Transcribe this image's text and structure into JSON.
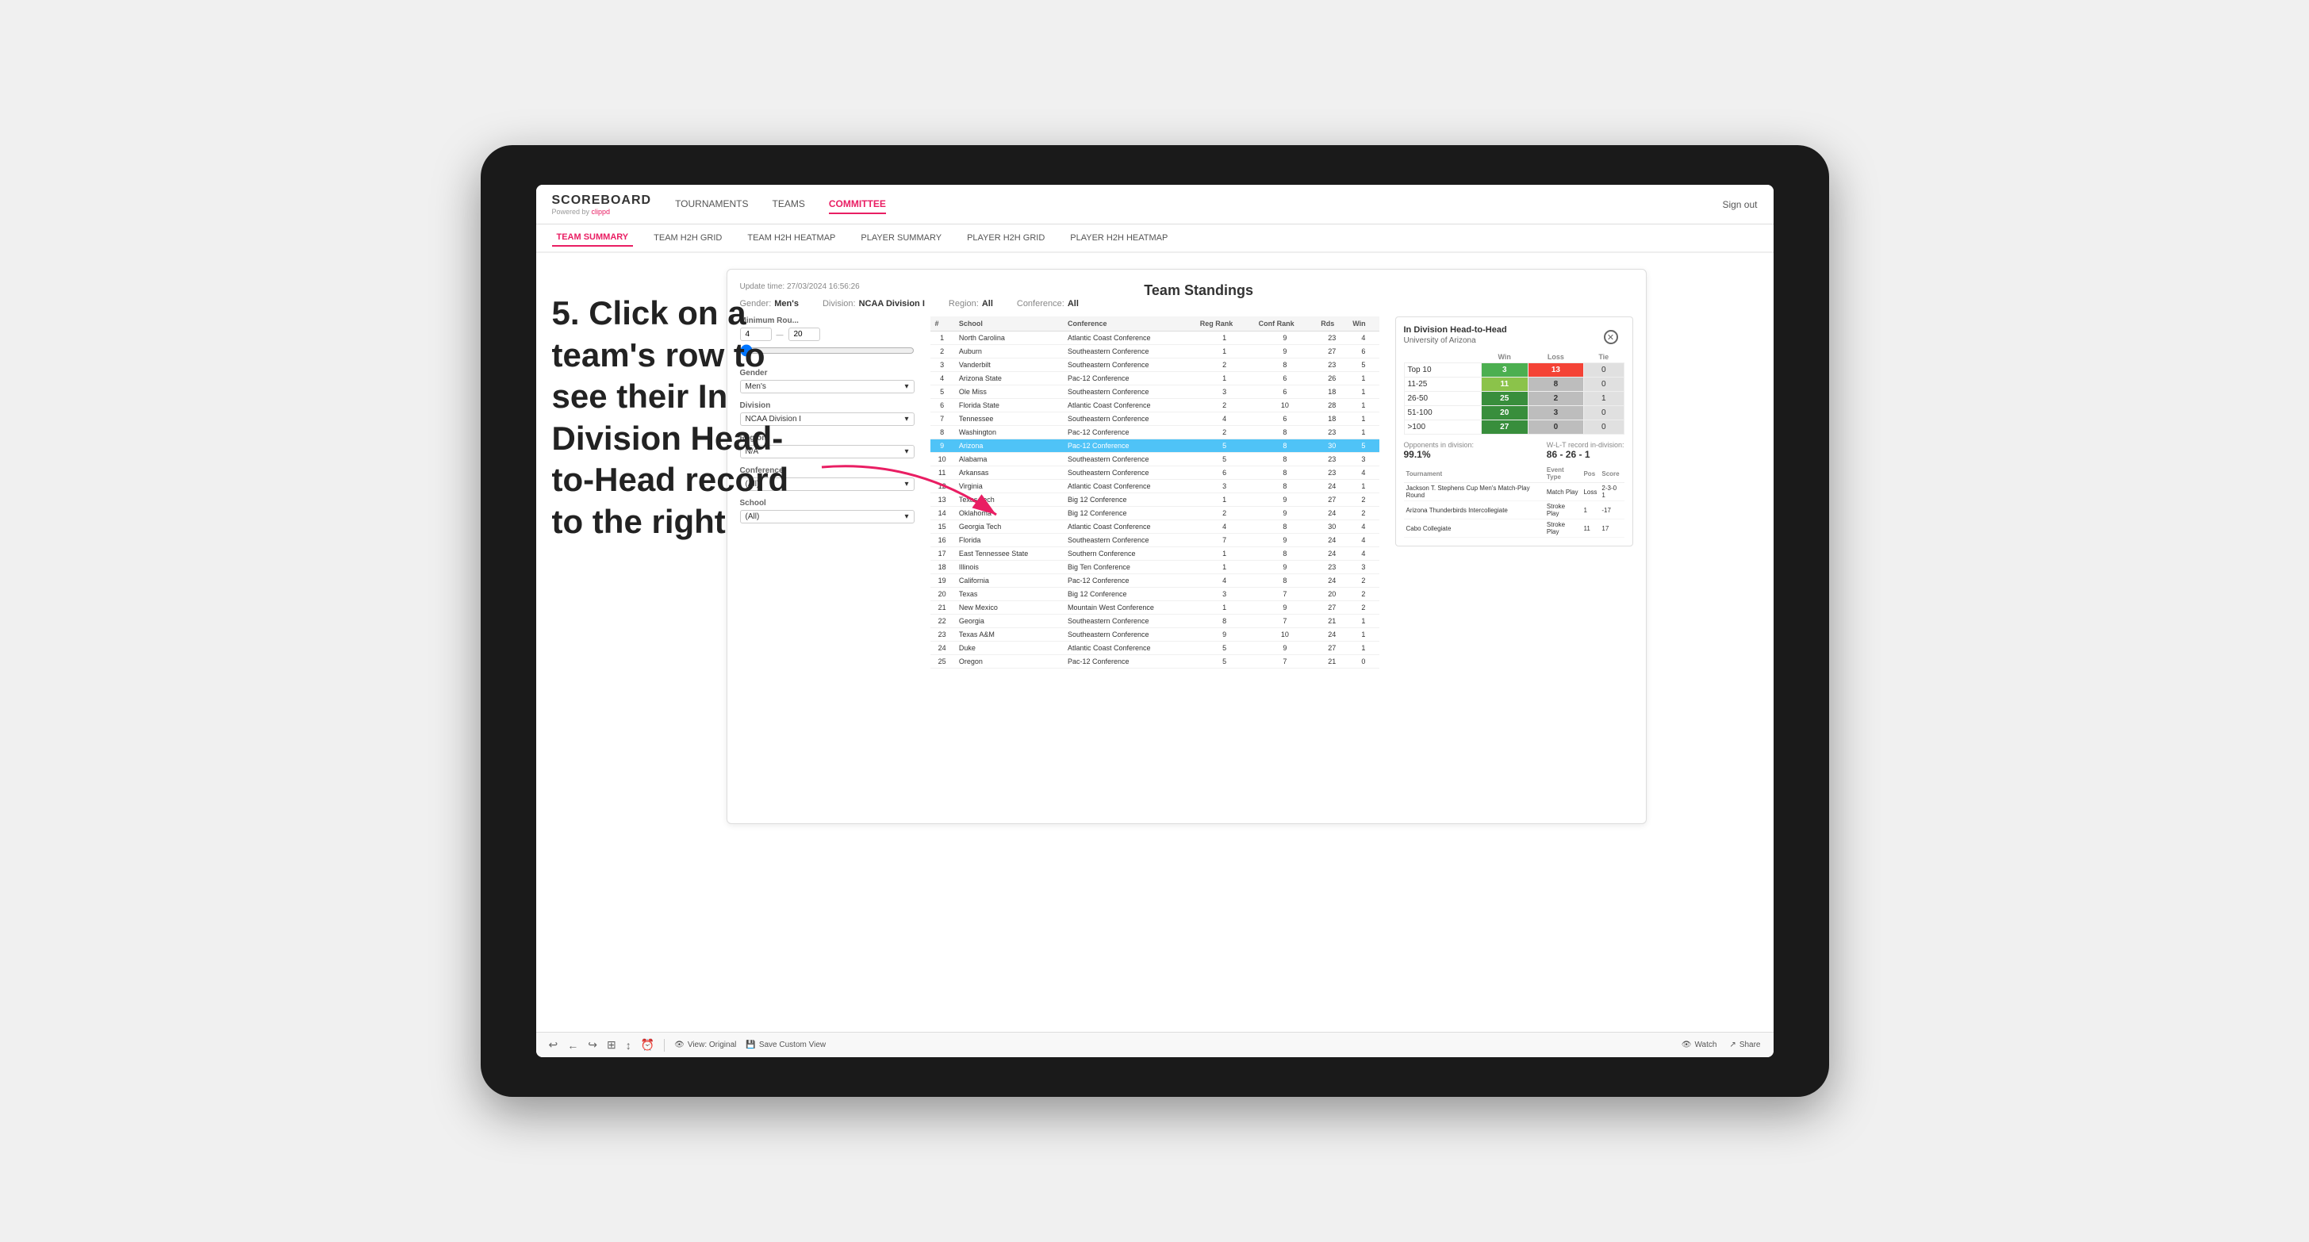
{
  "page": {
    "background": "#e8e8e8"
  },
  "annotation": {
    "text": "5. Click on a team's row to see their In Division Head-to-Head record to the right"
  },
  "logo": {
    "title": "SCOREBOARD",
    "subtitle": "Powered by",
    "brand": "clippd"
  },
  "nav": {
    "items": [
      {
        "label": "TOURNAMENTS",
        "active": false
      },
      {
        "label": "TEAMS",
        "active": false
      },
      {
        "label": "COMMITTEE",
        "active": true
      }
    ],
    "sign_out": "Sign out"
  },
  "sub_nav": {
    "items": [
      {
        "label": "TEAM SUMMARY",
        "active": true
      },
      {
        "label": "TEAM H2H GRID",
        "active": false
      },
      {
        "label": "TEAM H2H HEATMAP",
        "active": false
      },
      {
        "label": "PLAYER SUMMARY",
        "active": false
      },
      {
        "label": "PLAYER H2H GRID",
        "active": false
      },
      {
        "label": "PLAYER H2H HEATMAP",
        "active": false
      }
    ]
  },
  "panel": {
    "title": "Team Standings",
    "update_time": "Update time:",
    "update_date": "27/03/2024 16:56:26",
    "filters": {
      "gender": {
        "label": "Gender:",
        "value": "Men's"
      },
      "division": {
        "label": "Division:",
        "value": "NCAA Division I"
      },
      "region": {
        "label": "Region:",
        "value": "All"
      },
      "conference": {
        "label": "Conference:",
        "value": "All"
      }
    }
  },
  "left_filters": {
    "minimum_rounds": {
      "label": "Minimum Rou...",
      "value": "4",
      "max": "20"
    },
    "gender": {
      "label": "Gender",
      "value": "Men's"
    },
    "division": {
      "label": "Division",
      "value": "NCAA Division I"
    },
    "region": {
      "label": "Region",
      "value": "N/A"
    },
    "conference": {
      "label": "Conference",
      "value": "(All)"
    },
    "school": {
      "label": "School",
      "value": "(All)"
    }
  },
  "table": {
    "headers": [
      "#",
      "School",
      "Conference",
      "Reg Rank",
      "Conf Rank",
      "Rds",
      "Win"
    ],
    "rows": [
      {
        "num": 1,
        "school": "North Carolina",
        "conference": "Atlantic Coast Conference",
        "reg_rank": 1,
        "conf_rank": 9,
        "rds": 23,
        "win": 4
      },
      {
        "num": 2,
        "school": "Auburn",
        "conference": "Southeastern Conference",
        "reg_rank": 1,
        "conf_rank": 9,
        "rds": 27,
        "win": 6
      },
      {
        "num": 3,
        "school": "Vanderbilt",
        "conference": "Southeastern Conference",
        "reg_rank": 2,
        "conf_rank": 8,
        "rds": 23,
        "win": 5
      },
      {
        "num": 4,
        "school": "Arizona State",
        "conference": "Pac-12 Conference",
        "reg_rank": 1,
        "conf_rank": 6,
        "rds": 26,
        "win": 1
      },
      {
        "num": 5,
        "school": "Ole Miss",
        "conference": "Southeastern Conference",
        "reg_rank": 3,
        "conf_rank": 6,
        "rds": 18,
        "win": 1
      },
      {
        "num": 6,
        "school": "Florida State",
        "conference": "Atlantic Coast Conference",
        "reg_rank": 2,
        "conf_rank": 10,
        "rds": 28,
        "win": 1
      },
      {
        "num": 7,
        "school": "Tennessee",
        "conference": "Southeastern Conference",
        "reg_rank": 4,
        "conf_rank": 6,
        "rds": 18,
        "win": 1
      },
      {
        "num": 8,
        "school": "Washington",
        "conference": "Pac-12 Conference",
        "reg_rank": 2,
        "conf_rank": 8,
        "rds": 23,
        "win": 1
      },
      {
        "num": 9,
        "school": "Arizona",
        "conference": "Pac-12 Conference",
        "reg_rank": 5,
        "conf_rank": 8,
        "rds": 30,
        "win": 5,
        "highlighted": true
      },
      {
        "num": 10,
        "school": "Alabama",
        "conference": "Southeastern Conference",
        "reg_rank": 5,
        "conf_rank": 8,
        "rds": 23,
        "win": 3
      },
      {
        "num": 11,
        "school": "Arkansas",
        "conference": "Southeastern Conference",
        "reg_rank": 6,
        "conf_rank": 8,
        "rds": 23,
        "win": 4
      },
      {
        "num": 12,
        "school": "Virginia",
        "conference": "Atlantic Coast Conference",
        "reg_rank": 3,
        "conf_rank": 8,
        "rds": 24,
        "win": 1
      },
      {
        "num": 13,
        "school": "Texas Tech",
        "conference": "Big 12 Conference",
        "reg_rank": 1,
        "conf_rank": 9,
        "rds": 27,
        "win": 2
      },
      {
        "num": 14,
        "school": "Oklahoma",
        "conference": "Big 12 Conference",
        "reg_rank": 2,
        "conf_rank": 9,
        "rds": 24,
        "win": 2
      },
      {
        "num": 15,
        "school": "Georgia Tech",
        "conference": "Atlantic Coast Conference",
        "reg_rank": 4,
        "conf_rank": 8,
        "rds": 30,
        "win": 4
      },
      {
        "num": 16,
        "school": "Florida",
        "conference": "Southeastern Conference",
        "reg_rank": 7,
        "conf_rank": 9,
        "rds": 24,
        "win": 4
      },
      {
        "num": 17,
        "school": "East Tennessee State",
        "conference": "Southern Conference",
        "reg_rank": 1,
        "conf_rank": 8,
        "rds": 24,
        "win": 4
      },
      {
        "num": 18,
        "school": "Illinois",
        "conference": "Big Ten Conference",
        "reg_rank": 1,
        "conf_rank": 9,
        "rds": 23,
        "win": 3
      },
      {
        "num": 19,
        "school": "California",
        "conference": "Pac-12 Conference",
        "reg_rank": 4,
        "conf_rank": 8,
        "rds": 24,
        "win": 2
      },
      {
        "num": 20,
        "school": "Texas",
        "conference": "Big 12 Conference",
        "reg_rank": 3,
        "conf_rank": 7,
        "rds": 20,
        "win": 2
      },
      {
        "num": 21,
        "school": "New Mexico",
        "conference": "Mountain West Conference",
        "reg_rank": 1,
        "conf_rank": 9,
        "rds": 27,
        "win": 2
      },
      {
        "num": 22,
        "school": "Georgia",
        "conference": "Southeastern Conference",
        "reg_rank": 8,
        "conf_rank": 7,
        "rds": 21,
        "win": 1
      },
      {
        "num": 23,
        "school": "Texas A&M",
        "conference": "Southeastern Conference",
        "reg_rank": 9,
        "conf_rank": 10,
        "rds": 24,
        "win": 1
      },
      {
        "num": 24,
        "school": "Duke",
        "conference": "Atlantic Coast Conference",
        "reg_rank": 5,
        "conf_rank": 9,
        "rds": 27,
        "win": 1
      },
      {
        "num": 25,
        "school": "Oregon",
        "conference": "Pac-12 Conference",
        "reg_rank": 5,
        "conf_rank": 7,
        "rds": 21,
        "win": 0
      }
    ]
  },
  "h2h": {
    "title": "In Division Head-to-Head",
    "team": "University of Arizona",
    "col_headers": [
      "Win",
      "Loss",
      "Tie"
    ],
    "rows": [
      {
        "label": "Top 10",
        "win": 3,
        "loss": 13,
        "tie": 0,
        "win_color": "green",
        "loss_color": "red"
      },
      {
        "label": "11-25",
        "win": 11,
        "loss": 8,
        "tie": 0,
        "win_color": "light-green",
        "loss_color": "gray"
      },
      {
        "label": "26-50",
        "win": 25,
        "loss": 2,
        "tie": 1,
        "win_color": "dark-green",
        "loss_color": "gray"
      },
      {
        "label": "51-100",
        "win": 20,
        "loss": 3,
        "tie": 0,
        "win_color": "dark-green",
        "loss_color": "gray"
      },
      {
        "label": ">100",
        "win": 27,
        "loss": 0,
        "tie": 0,
        "win_color": "dark-green",
        "loss_color": "gray"
      }
    ],
    "opponents_label": "Opponents in division:",
    "opponents_value": "99.1%",
    "wlt_label": "W-L-T record in-division:",
    "wlt_value": "86 - 26 - 1",
    "tournaments": {
      "label": "Tournament",
      "headers": [
        "Tournament",
        "Event Type",
        "Pos",
        "Score"
      ],
      "rows": [
        {
          "tournament": "Jackson T. Stephens Cup Men's Match-Play Round",
          "type": "Match Play",
          "pos": "Loss",
          "score": "2-3-0 1"
        },
        {
          "tournament": "Arizona Thunderbirds Intercollegiate",
          "type": "Stroke Play",
          "pos": "1",
          "score": "-17"
        },
        {
          "tournament": "Cabo Collegiate",
          "type": "Stroke Play",
          "pos": "11",
          "score": "17"
        }
      ]
    }
  },
  "toolbar": {
    "icons": [
      "↩",
      "←",
      "↪",
      "⊞",
      "↕",
      "⏰"
    ],
    "view_original": "View: Original",
    "save_custom": "Save Custom View",
    "watch": "Watch",
    "share": "Share"
  }
}
